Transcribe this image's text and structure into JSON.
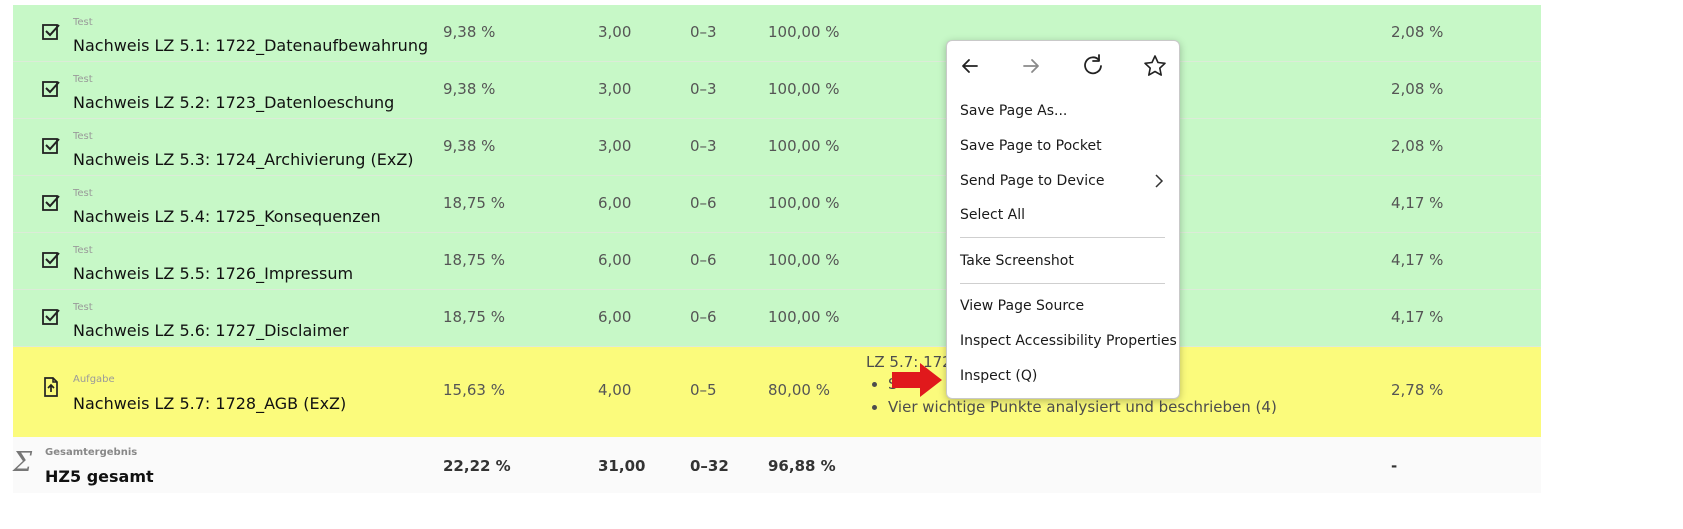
{
  "rows": [
    {
      "type": "Test",
      "name": "Nachweis LZ 5.1: 1722_Datenaufbewahrung",
      "weight": "9,38 %",
      "points": "3,00",
      "range": "0–3",
      "percent": "100,00 %",
      "contribution": "2,08 %"
    },
    {
      "type": "Test",
      "name": "Nachweis LZ 5.2: 1723_Datenloeschung",
      "weight": "9,38 %",
      "points": "3,00",
      "range": "0–3",
      "percent": "100,00 %",
      "contribution": "2,08 %"
    },
    {
      "type": "Test",
      "name": "Nachweis LZ 5.3: 1724_Archivierung (ExZ)",
      "weight": "9,38 %",
      "points": "3,00",
      "range": "0–3",
      "percent": "100,00 %",
      "contribution": "2,08 %"
    },
    {
      "type": "Test",
      "name": "Nachweis LZ 5.4: 1725_Konsequenzen",
      "weight": "18,75 %",
      "points": "6,00",
      "range": "0–6",
      "percent": "100,00 %",
      "contribution": "4,17 %"
    },
    {
      "type": "Test",
      "name": "Nachweis LZ 5.5: 1726_Impressum",
      "weight": "18,75 %",
      "points": "6,00",
      "range": "0–6",
      "percent": "100,00 %",
      "contribution": "4,17 %"
    },
    {
      "type": "Test",
      "name": "Nachweis LZ 5.6: 1727_Disclaimer",
      "weight": "18,75 %",
      "points": "6,00",
      "range": "0–6",
      "percent": "100,00 %",
      "contribution": "4,17 %"
    }
  ],
  "assignment": {
    "type": "Aufgabe",
    "name": "Nachweis LZ 5.7: 1728_AGB (ExZ)",
    "weight": "15,63 %",
    "points": "4,00",
    "range": "0–5",
    "percent": "80,00 %",
    "contribution": "2,78 %",
    "feedback_title": "LZ 5.7: 1728",
    "feedback_items": [
      "S",
      "Vier wichtige Punkte analysiert und beschrieben (4)"
    ]
  },
  "total": {
    "symbol": "Σ",
    "type": "Gesamtergebnis",
    "name": "HZ5 gesamt",
    "weight": "22,22 %",
    "points": "31,00",
    "range": "0–32",
    "percent": "96,88 %",
    "contribution": "-"
  },
  "context_menu": {
    "items": [
      "Save Page As...",
      "Save Page to Pocket",
      "Send Page to Device",
      "Select All",
      "Take Screenshot",
      "View Page Source",
      "Inspect Accessibility Properties",
      "Inspect (Q)"
    ]
  },
  "colors": {
    "passed_row": "#c7f8c7",
    "pending_row": "#fbfb7c",
    "arrow": "#e0191c"
  }
}
